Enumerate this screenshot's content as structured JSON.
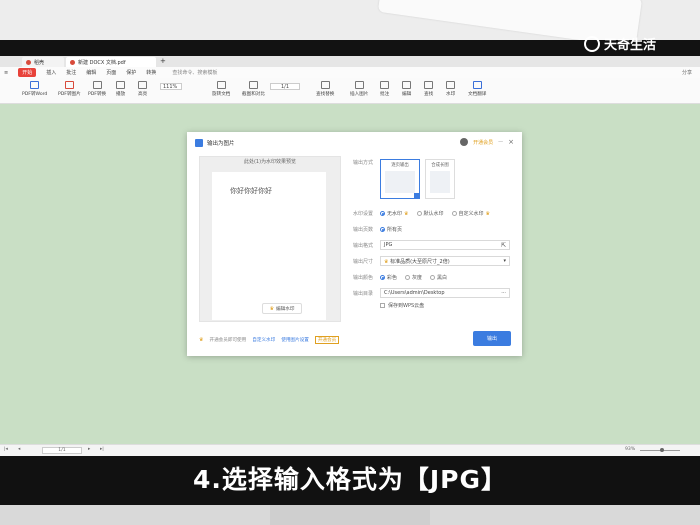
{
  "watermark": {
    "brand": "天奇生活",
    "corner_char": "天"
  },
  "tabs": [
    {
      "label": "稻壳",
      "color": "#d84a3a"
    },
    {
      "label": "新建 DOCX 文档.pdf",
      "color": "#d84a3a"
    }
  ],
  "menubar": {
    "items": [
      "开始",
      "插入",
      "批注",
      "编辑",
      "页面",
      "保护",
      "转换"
    ],
    "active": "开始",
    "search_placeholder": "查找命令、搜索模板",
    "right_text": "分享"
  },
  "toolbar": {
    "items": [
      "PDF转Word",
      "PDF转图片",
      "PDF转换",
      "播放",
      "高亮",
      "旋转文档",
      "截图和对比",
      "查找替换",
      "插入图片",
      "批注",
      "编辑",
      "查找",
      "水印",
      "文档翻译"
    ],
    "zoom": "111%",
    "page": "1/1"
  },
  "dialog": {
    "title": "输出为图片",
    "vip_label": "开通会员",
    "preview_header": "此处(1)为水印效果预览",
    "preview_text": "你好你好你好",
    "edit_button": "编辑水印",
    "mode_label": "输出方式",
    "mode_options": [
      "逐页输出",
      "合成长图"
    ],
    "watermark_label": "水印设置",
    "watermark_options": [
      "无水印",
      "默认水印",
      "自定义水印"
    ],
    "pages_label": "输出页数",
    "pages_option": "所有页",
    "format_label": "输出格式",
    "format_value": "JPG",
    "quality_label": "输出尺寸",
    "quality_value": "标准品质(大至原尺寸_2倍)",
    "color_label": "输出颜色",
    "color_options": [
      "彩色",
      "灰度",
      "黑白"
    ],
    "dir_label": "输出目录",
    "dir_value": "C:\\Users\\admin\\Desktop",
    "save_wps_label": "保存到WPS云盘",
    "footer_links": [
      "开通会员即可使用",
      "自定义水印",
      "使用图片设置"
    ],
    "footer_box": "开通会员",
    "export_button": "输出"
  },
  "statusbar": {
    "page": "1/1",
    "zoom": "93%"
  },
  "subtitle": "4.选择输入格式为【JPG】"
}
